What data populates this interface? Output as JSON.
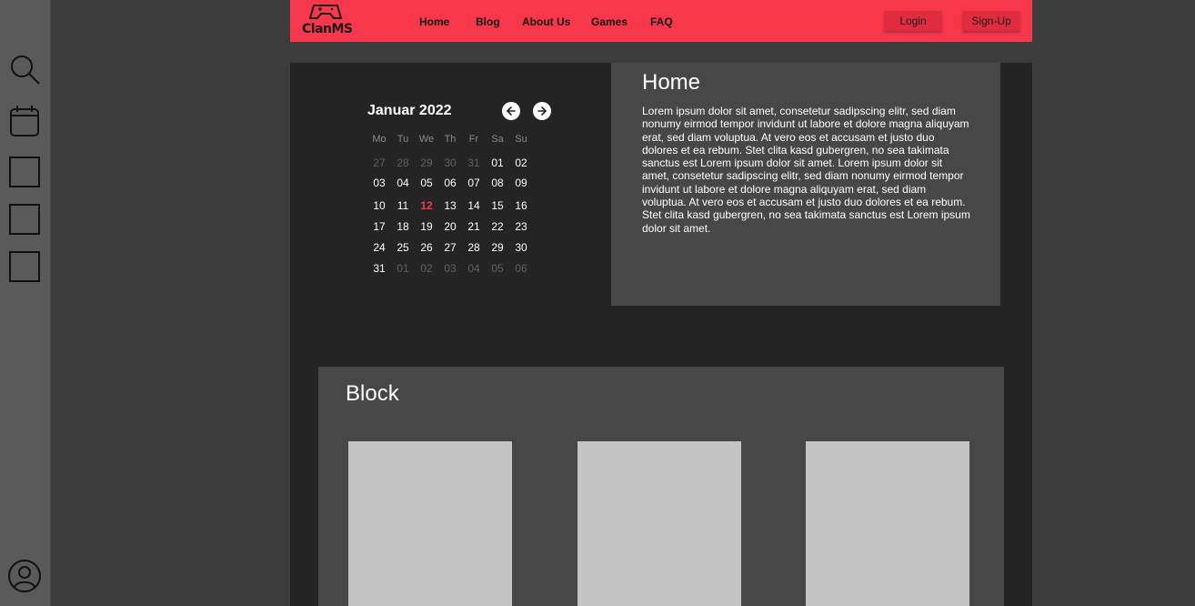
{
  "sidebar": {
    "icons": [
      "search-icon",
      "calendar-icon",
      "square-icon",
      "square-icon",
      "square-icon",
      "user-icon"
    ]
  },
  "navbar": {
    "logo_text": "ClanMS",
    "links": [
      "Home",
      "Blog",
      "About Us",
      "Games",
      "FAQ"
    ],
    "login_label": "Login",
    "signup_label": "Sign-Up",
    "colors": {
      "accent": "#f7374c",
      "button": "#e02c41"
    }
  },
  "calendar": {
    "title": "Januar 2022",
    "weekdays": [
      "Mo",
      "Tu",
      "We",
      "Th",
      "Fr",
      "Sa",
      "Su"
    ],
    "weeks": [
      [
        "27",
        "28",
        "29",
        "30",
        "31",
        "01",
        "02"
      ],
      [
        "03",
        "04",
        "05",
        "06",
        "07",
        "08",
        "09"
      ],
      [
        "10",
        "11",
        "12",
        "13",
        "14",
        "15",
        "16"
      ],
      [
        "17",
        "18",
        "19",
        "20",
        "21",
        "22",
        "23"
      ],
      [
        "24",
        "25",
        "26",
        "27",
        "28",
        "29",
        "30"
      ],
      [
        "31",
        "01",
        "02",
        "03",
        "04",
        "05",
        "06"
      ]
    ],
    "today": "12",
    "prev_icon": "arrow-left-icon",
    "next_icon": "arrow-right-icon"
  },
  "home": {
    "title": "Home",
    "body": "Lorem ipsum dolor sit amet, consetetur sadipscing elitr, sed diam nonumy eirmod tempor invidunt ut labore et dolore magna aliquyam erat, sed diam voluptua. At vero eos et accusam et justo duo dolores et ea rebum. Stet clita kasd gubergren, no sea takimata sanctus est Lorem ipsum dolor sit amet. Lorem ipsum dolor sit amet, consetetur sadipscing elitr, sed diam nonumy eirmod tempor invidunt ut labore et dolore magna aliquyam erat, sed diam voluptua. At vero eos et accusam et justo duo dolores et ea rebum. Stet clita kasd gubergren, no sea takimata sanctus est Lorem ipsum dolor sit amet."
  },
  "block": {
    "title": "Block"
  }
}
